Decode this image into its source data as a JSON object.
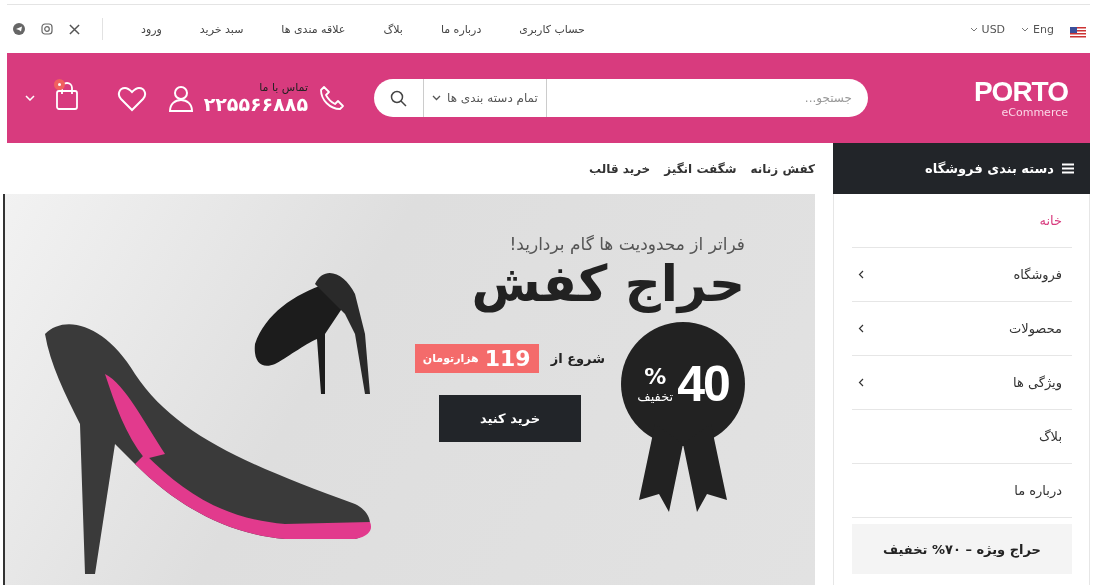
{
  "top_bar": {
    "language": "Eng",
    "currency": "USD",
    "links": [
      "حساب کاربری",
      "درباره ما",
      "بلاگ",
      "علاقه مندی ها",
      "سبد خرید",
      "ورود"
    ]
  },
  "header": {
    "logo": {
      "title": "PORTO",
      "subtitle": "eCommerce"
    },
    "search": {
      "placeholder": "جستجو...",
      "category": "تمام دسته بندی ها"
    },
    "contact": {
      "label": "تماس با ما",
      "phone": "۲۲۵۵۶۶۸۸۵"
    }
  },
  "nav_links": [
    "کفش زنانه",
    "شگفت انگیز",
    "خرید قالب"
  ],
  "banner": {
    "subtitle": "فراتر از محدودیت ها گام بردارید!",
    "title": "حراج کفش",
    "price_prefix": "شروع از",
    "price": "119",
    "price_unit": "هزارتومان",
    "button": "خرید کنید",
    "discount": {
      "value": "40",
      "percent": "%",
      "label": "تخفیف"
    }
  },
  "sidebar": {
    "title": "دسته بندی فروشگاه",
    "items": [
      {
        "label": "خانه",
        "selected": true,
        "has_submenu": false
      },
      {
        "label": "فروشگاه",
        "selected": false,
        "has_submenu": true
      },
      {
        "label": "محصولات",
        "selected": false,
        "has_submenu": true
      },
      {
        "label": "ویژگی ها",
        "selected": false,
        "has_submenu": true
      },
      {
        "label": "بلاگ",
        "selected": false,
        "has_submenu": false
      },
      {
        "label": "درباره ما",
        "selected": false,
        "has_submenu": false
      }
    ],
    "promo": "حراج ویژه – ۷۰% تخفیف"
  }
}
